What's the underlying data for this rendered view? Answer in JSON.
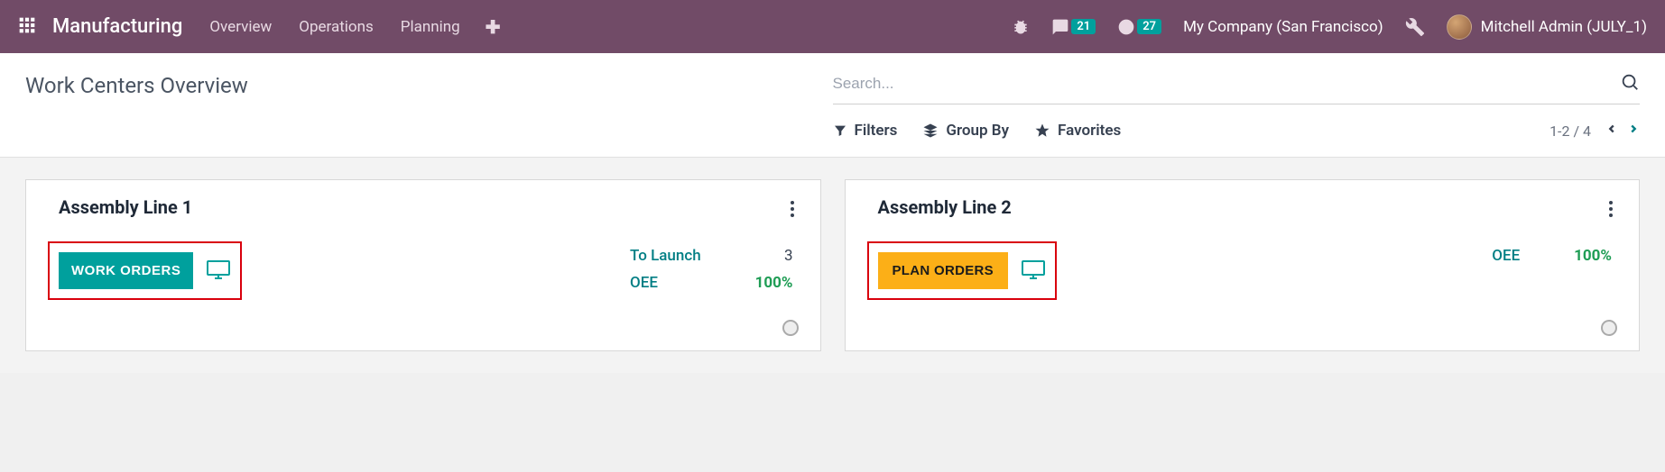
{
  "nav": {
    "brand": "Manufacturing",
    "menu": [
      "Overview",
      "Operations",
      "Planning"
    ],
    "messages_badge": "21",
    "activities_badge": "27",
    "company": "My Company (San Francisco)",
    "user": "Mitchell Admin (JULY_1)"
  },
  "page": {
    "title": "Work Centers Overview",
    "search_placeholder": "Search...",
    "filters_label": "Filters",
    "groupby_label": "Group By",
    "favorites_label": "Favorites",
    "pager": "1-2 / 4"
  },
  "cards": [
    {
      "title": "Assembly Line 1",
      "button_label": "WORK ORDERS",
      "button_style": "primary",
      "metrics": [
        {
          "label": "To Launch",
          "value": "3",
          "value_style": "normal"
        },
        {
          "label": "OEE",
          "value": "100%",
          "value_style": "green"
        }
      ]
    },
    {
      "title": "Assembly Line 2",
      "button_label": "PLAN ORDERS",
      "button_style": "secondary",
      "metrics": [
        {
          "label": "OEE",
          "value": "100%",
          "value_style": "green"
        }
      ]
    }
  ]
}
